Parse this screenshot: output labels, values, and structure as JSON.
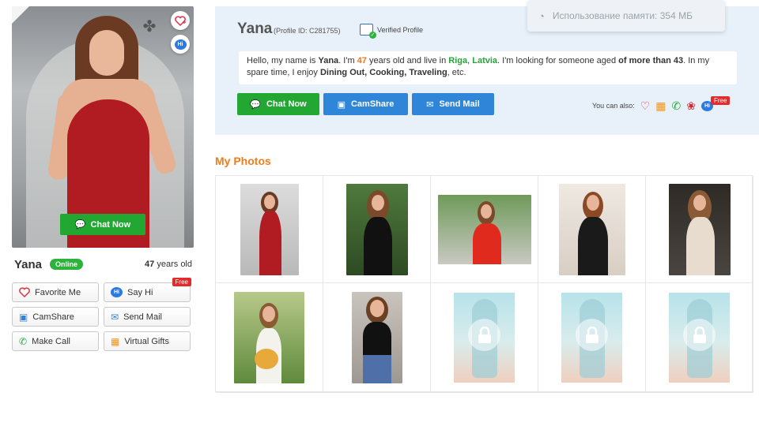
{
  "profile": {
    "name": "Yana",
    "online": "Online",
    "age_number": "47",
    "age_suffix": "years old",
    "profile_id": "(Profile ID: C281755)",
    "verified": "Verified Profile"
  },
  "memory_popup": "Использование памяти: 354 МБ",
  "about": {
    "t1": "Hello, my name is ",
    "name": "Yana",
    "t2": ". I'm ",
    "age": "47",
    "t3": " years old and live in ",
    "city": "Riga",
    "comma": ", ",
    "country": "Latvia",
    "t4": ". I'm looking for someone aged ",
    "aged": "of more than 43",
    "t5": ". In my spare time, I enjoy ",
    "hobbies": "Dining Out, Cooking, Traveling",
    "t6": ", etc."
  },
  "buttons": {
    "chat_now": "Chat Now",
    "camshare": "CamShare",
    "send_mail": "Send Mail",
    "photo_chat_now": "Chat Now",
    "you_can_also": "You can also:",
    "free": "Free"
  },
  "left_actions": {
    "favorite": "Favorite Me",
    "say_hi": "Say Hi",
    "camshare": "CamShare",
    "send_mail": "Send Mail",
    "make_call": "Make Call",
    "virtual_gifts": "Virtual Gifts",
    "free": "Free"
  },
  "photos_title": "My Photos",
  "colors": {
    "green": "#22a832",
    "blue": "#2f86d8",
    "orange": "#f07c1e",
    "red": "#e22b2b",
    "panel": "#e8f1f9"
  },
  "icons": [
    "heart-plus-icon",
    "hi-bubble-icon",
    "chat-icon",
    "camshare-icon",
    "mail-icon",
    "phone-icon",
    "gift-icon",
    "rose-icon",
    "lock-icon",
    "gauge-icon"
  ]
}
